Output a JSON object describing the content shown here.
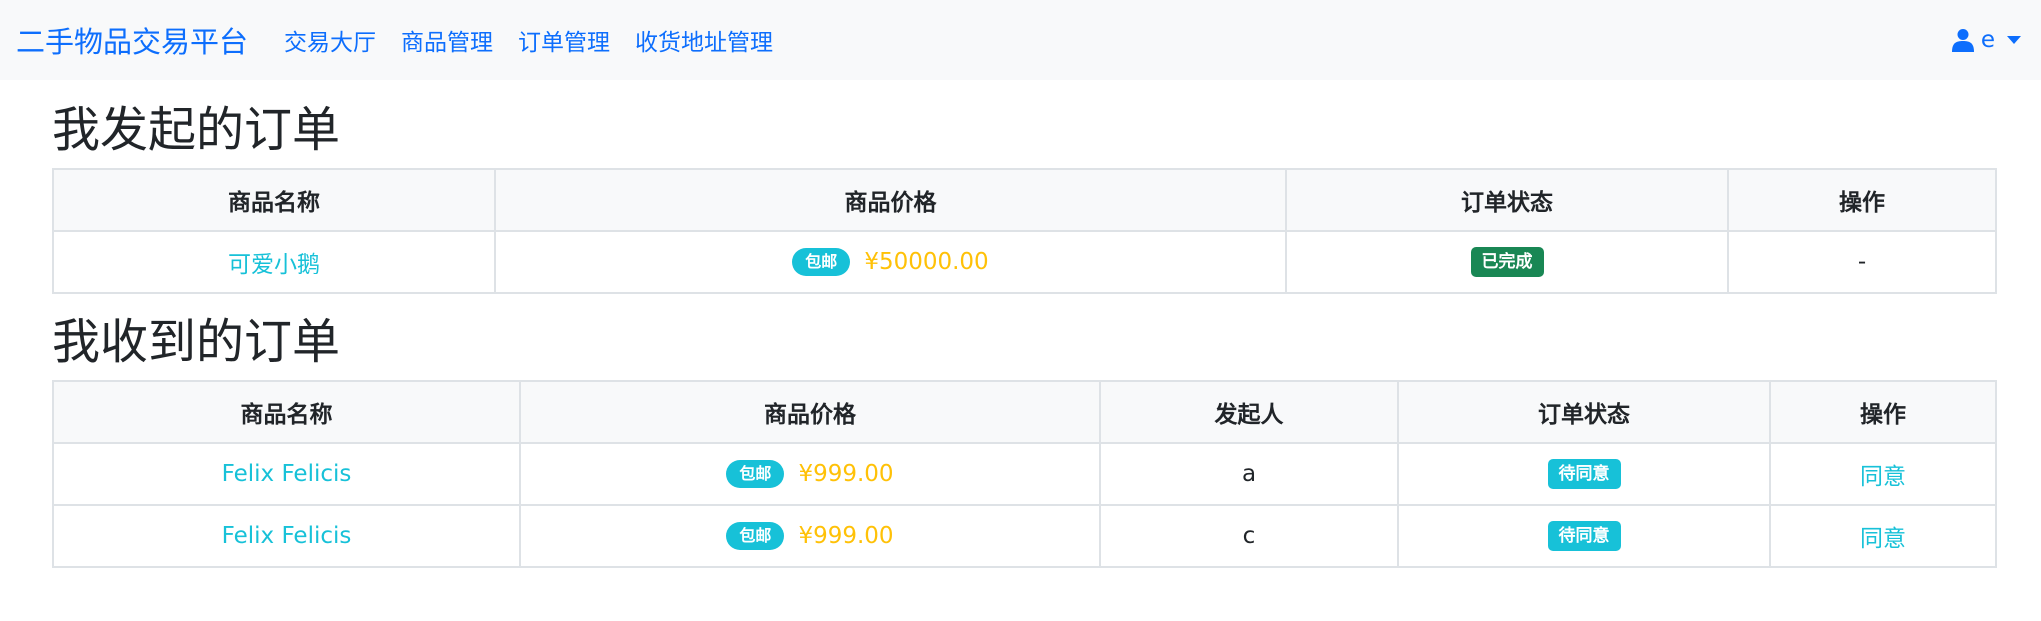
{
  "nav": {
    "brand": "二手物品交易平台",
    "links": [
      "交易大厅",
      "商品管理",
      "订单管理",
      "收货地址管理"
    ],
    "user": "e"
  },
  "sent_orders": {
    "title": "我发起的订单",
    "headers": [
      "商品名称",
      "商品价格",
      "订单状态",
      "操作"
    ],
    "rows": [
      {
        "name": "可爱小鹅",
        "shipping": "包邮",
        "price": "¥50000.00",
        "status": "已完成",
        "action": "-"
      }
    ]
  },
  "received_orders": {
    "title": "我收到的订单",
    "headers": [
      "商品名称",
      "商品价格",
      "发起人",
      "订单状态",
      "操作"
    ],
    "rows": [
      {
        "name": "Felix Felicis",
        "shipping": "包邮",
        "price": "¥999.00",
        "initiator": "a",
        "status": "待同意",
        "action": "同意"
      },
      {
        "name": "Felix Felicis",
        "shipping": "包邮",
        "price": "¥999.00",
        "initiator": "c",
        "status": "待同意",
        "action": "同意"
      }
    ]
  },
  "colors": {
    "primary": "#0d6efd",
    "info": "#17c1d8",
    "warning": "#ffc107",
    "success": "#198754"
  },
  "icons": {
    "user": "user-icon",
    "dropdown": "caret-down-icon"
  }
}
